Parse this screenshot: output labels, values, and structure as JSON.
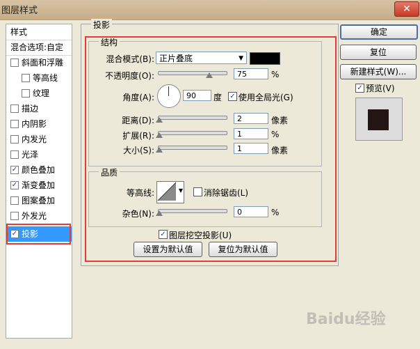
{
  "window": {
    "title": "图层样式",
    "close_glyph": "✕"
  },
  "style_list": {
    "header": "样式",
    "blend_options": "混合选项:自定",
    "items": [
      {
        "label": "斜面和浮雕",
        "checked": false
      },
      {
        "label": "等高线",
        "checked": false
      },
      {
        "label": "纹理",
        "checked": false
      },
      {
        "label": "描边",
        "checked": false
      },
      {
        "label": "内阴影",
        "checked": false
      },
      {
        "label": "内发光",
        "checked": false
      },
      {
        "label": "光泽",
        "checked": false
      },
      {
        "label": "颜色叠加",
        "checked": true
      },
      {
        "label": "渐变叠加",
        "checked": true
      },
      {
        "label": "图案叠加",
        "checked": false
      },
      {
        "label": "外发光",
        "checked": false
      },
      {
        "label": "投影",
        "checked": true,
        "selected": true
      }
    ]
  },
  "panel": {
    "title": "投影",
    "structure": {
      "title": "结构",
      "blend_mode_label": "混合模式(B):",
      "blend_mode_value": "正片叠底",
      "shadow_color": "#000000",
      "opacity_label": "不透明度(O):",
      "opacity_value": "75",
      "opacity_unit": "%",
      "opacity_level": 0.75,
      "angle_label": "角度(A):",
      "angle_value": "90",
      "angle_unit": "度",
      "global_light_label": "使用全局光(G)",
      "global_light_checked": true,
      "distance_label": "距离(D):",
      "distance_value": "2",
      "distance_unit": "像素",
      "spread_label": "扩展(R):",
      "spread_value": "1",
      "spread_unit": "%",
      "size_label": "大小(S):",
      "size_value": "1",
      "size_unit": "像素"
    },
    "quality": {
      "title": "品质",
      "contour_label": "等高线:",
      "anti_alias_label": "消除锯齿(L)",
      "anti_alias_checked": false,
      "noise_label": "杂色(N):",
      "noise_value": "0",
      "noise_unit": "%"
    },
    "knockout_label": "图层挖空投影(U)",
    "knockout_checked": true,
    "make_default_button": "设置为默认值",
    "reset_default_button": "复位为默认值"
  },
  "right": {
    "ok_button": "确定",
    "reset_button": "复位",
    "new_style_button": "新建样式(W)...",
    "preview_label": "预览(V)",
    "preview_checked": true,
    "preview_color": "#231615"
  },
  "watermark": "Baidu经验"
}
